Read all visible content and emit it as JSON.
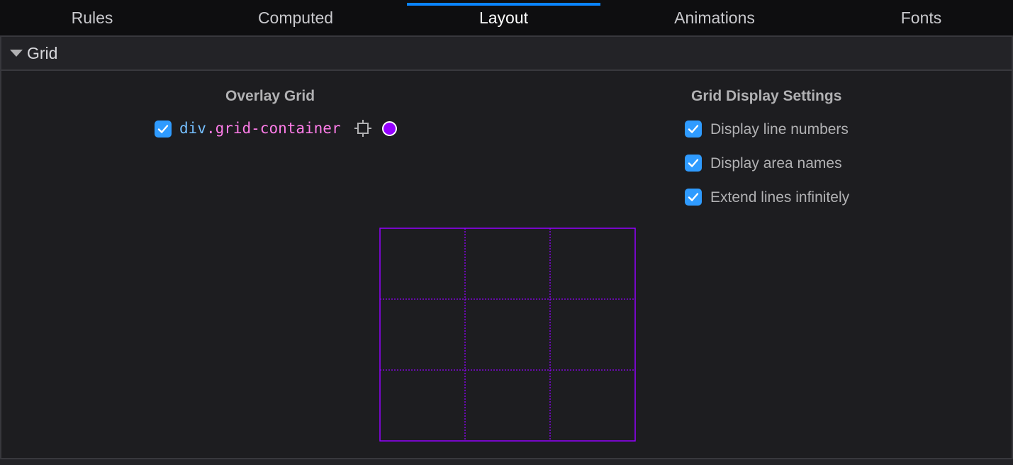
{
  "tabs": [
    {
      "label": "Rules",
      "active": false
    },
    {
      "label": "Computed",
      "active": false
    },
    {
      "label": "Layout",
      "active": true
    },
    {
      "label": "Animations",
      "active": false
    },
    {
      "label": "Fonts",
      "active": false
    }
  ],
  "accordion": {
    "label": "Grid",
    "expanded": true
  },
  "overlay_grid": {
    "heading": "Overlay Grid",
    "items": [
      {
        "tag": "div",
        "class_name": ".grid-container",
        "checked": true,
        "color": "#9400ff"
      }
    ]
  },
  "display_settings": {
    "heading": "Grid Display Settings",
    "options": [
      {
        "label": "Display line numbers",
        "checked": true
      },
      {
        "label": "Display area names",
        "checked": true
      },
      {
        "label": "Extend lines infinitely",
        "checked": true
      }
    ]
  },
  "grid_outline": {
    "rows": 3,
    "columns": 3,
    "color": "#9400ff"
  },
  "colors": {
    "accent": "#0a84ff",
    "checkbox": "#2f9bff",
    "grid": "#9400ff"
  }
}
